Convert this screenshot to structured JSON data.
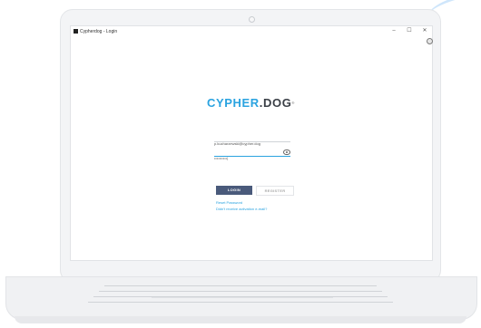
{
  "window": {
    "title": "Cypherdog - Login",
    "controls": {
      "minimize": "–",
      "maximize": "☐",
      "close": "✕"
    }
  },
  "logo": {
    "part_a": "CYPHER",
    "dot": ".",
    "part_b": "DOG",
    "mark": "®"
  },
  "login_form": {
    "email_value": "p.kucharzewski@cypher.dog",
    "password_value": "••••••••••|"
  },
  "buttons": {
    "login": "LOGIN",
    "register": "REGISTER"
  },
  "links": {
    "reset_password": "Reset Password",
    "no_email": "Didn't receive activation e-mail?"
  },
  "colors": {
    "accent": "#2aa3e0",
    "login_button": "#4a5a7b",
    "logo_dark": "#3a3f46"
  }
}
